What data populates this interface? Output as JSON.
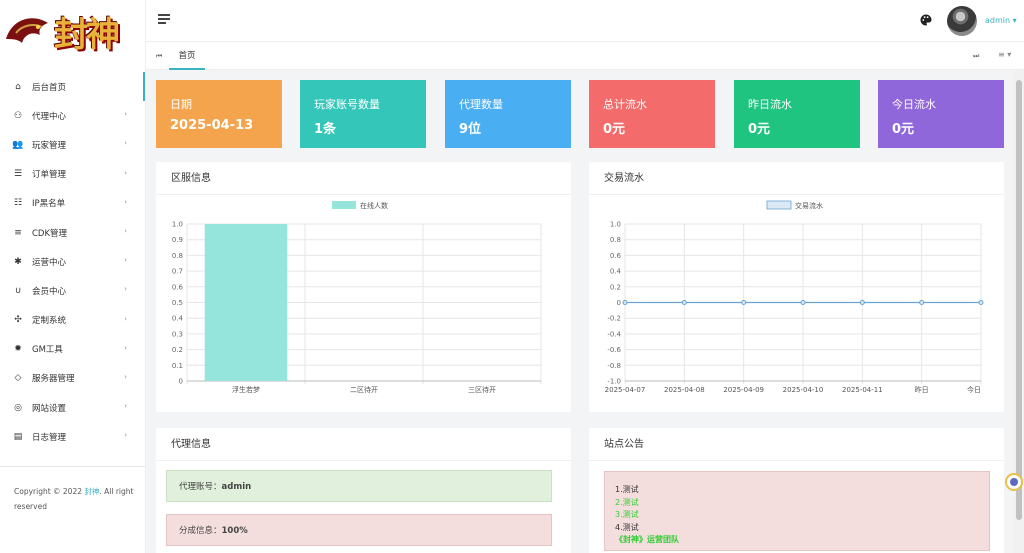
{
  "brand": {
    "logo_text": "封神"
  },
  "sidebar": {
    "items": [
      {
        "label": "后台首页",
        "icon": "home-icon",
        "arrow": false
      },
      {
        "label": "代理中心",
        "icon": "users-outline-icon",
        "arrow": true
      },
      {
        "label": "玩家管理",
        "icon": "users-icon",
        "arrow": true
      },
      {
        "label": "订单管理",
        "icon": "order-list-icon",
        "arrow": true
      },
      {
        "label": "IP黑名单",
        "icon": "blacklist-icon",
        "arrow": true
      },
      {
        "label": "CDK管理",
        "icon": "list-icon",
        "arrow": true
      },
      {
        "label": "运营中心",
        "icon": "gear-icon",
        "arrow": true
      },
      {
        "label": "会员中心",
        "icon": "magnet-icon",
        "arrow": true
      },
      {
        "label": "定制系统",
        "icon": "puzzle-icon",
        "arrow": true
      },
      {
        "label": "GM工具",
        "icon": "bug-icon",
        "arrow": true
      },
      {
        "label": "服务器管理",
        "icon": "diamond-icon",
        "arrow": true
      },
      {
        "label": "网站设置",
        "icon": "globe-icon",
        "arrow": true
      },
      {
        "label": "日志管理",
        "icon": "comment-icon",
        "arrow": true
      }
    ],
    "arrow_glyph": "›",
    "copyright_prefix": "Copyright © 2022 ",
    "copyright_brand": "封神",
    "copyright_suffix": ". All right reserved"
  },
  "header": {
    "user": "admin ▾"
  },
  "tabs": {
    "prev": "⏮",
    "home": "首页",
    "next": "⏭",
    "menu": "≡ ▾"
  },
  "stats": [
    {
      "label": "日期",
      "value": "2025-04-13",
      "color": "#f5a44e"
    },
    {
      "label": "玩家账号数量",
      "value": "1条",
      "color": "#34c6b8"
    },
    {
      "label": "代理数量",
      "value": "9位",
      "color": "#4aaef3"
    },
    {
      "label": "总计流水",
      "value": "0元",
      "color": "#f36b6b"
    },
    {
      "label": "昨日流水",
      "value": "0元",
      "color": "#1ec47f"
    },
    {
      "label": "今日流水",
      "value": "0元",
      "color": "#9066db"
    }
  ],
  "server_card": {
    "title": "区服信息"
  },
  "trade_card": {
    "title": "交易流水"
  },
  "agent_card": {
    "title": "代理信息",
    "account_label": "代理账号：",
    "account_value": "admin",
    "share_label": "分成信息：",
    "share_value": "100%"
  },
  "notice_card": {
    "title": "站点公告",
    "lines": [
      "1.测试",
      "2.测试",
      "3.测试",
      "4.测试",
      "《封神》运营团队"
    ]
  },
  "colors": {
    "accent": "#3bb2c1",
    "bar_fill": "#96e5dd",
    "line_stroke": "#6aa3d1"
  },
  "chart_data": [
    {
      "type": "bar",
      "categories": [
        "浮生若梦",
        "二区待开",
        "三区待开"
      ],
      "series": [
        {
          "name": "在线人数",
          "values": [
            1,
            0,
            0
          ]
        }
      ],
      "ylim": [
        0,
        1.0
      ],
      "yticks": [
        "1.0",
        "0.9",
        "0.8",
        "0.7",
        "0.6",
        "0.5",
        "0.4",
        "0.3",
        "0.2",
        "0.1",
        "0"
      ],
      "grid": true,
      "legend": "top-center"
    },
    {
      "type": "line",
      "categories": [
        "2025-04-07",
        "2025-04-08",
        "2025-04-09",
        "2025-04-10",
        "2025-04-11",
        "昨日",
        "今日"
      ],
      "series": [
        {
          "name": "交易流水",
          "values": [
            0,
            0,
            0,
            0,
            0,
            0,
            0
          ]
        }
      ],
      "ylim": [
        -1.0,
        1.0
      ],
      "yticks": [
        "1.0",
        "0.8",
        "0.6",
        "0.4",
        "0.2",
        "0",
        "-0.2",
        "-0.4",
        "-0.6",
        "-0.8",
        "-1.0"
      ],
      "grid": true,
      "legend": "top-center"
    }
  ]
}
